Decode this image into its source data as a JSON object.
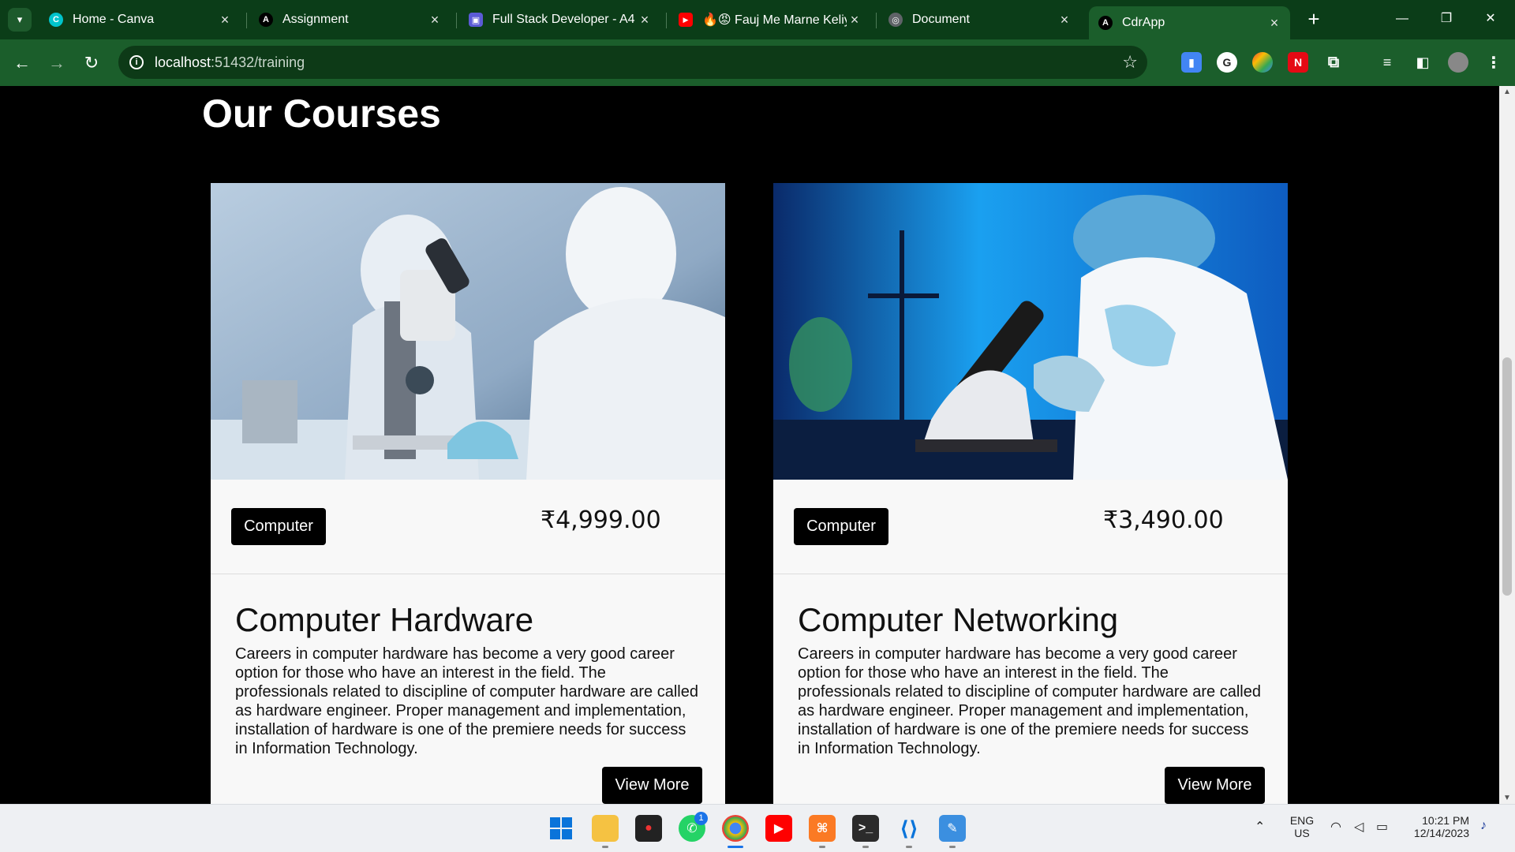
{
  "browser": {
    "tabs": [
      {
        "label": "Home - Canva",
        "fav": "C",
        "color": "#00c4cc"
      },
      {
        "label": "Assignment",
        "fav": "A",
        "color": "#000000"
      },
      {
        "label": "Full Stack Developer - A4",
        "fav": "▣",
        "color": "#5b5bd6"
      },
      {
        "label": "🔥😡 Fauj Me Marne Keliy",
        "fav": "▶",
        "color": "#ff0000"
      },
      {
        "label": "Document",
        "fav": "◎",
        "color": "#5f6368"
      },
      {
        "label": "CdrApp",
        "fav": "A",
        "color": "#000000"
      }
    ],
    "url_host": "localhost",
    "url_path": ":51432/training"
  },
  "page": {
    "title": "Our Courses",
    "courses": [
      {
        "category": "Computer",
        "price": "₹4,999.00",
        "name": "Computer Hardware",
        "description": "Careers in computer hardware has become a very good career option for those who have an interest in the field. The professionals related to discipline of computer hardware are called as hardware engineer. Proper management and implementation, installation of hardware is one of the premiere needs for success in Information Technology.",
        "button": "View More"
      },
      {
        "category": "Computer",
        "price": "₹3,490.00",
        "name": "Computer Networking",
        "description": "Careers in computer hardware has become a very good career option for those who have an interest in the field. The professionals related to discipline of computer hardware are called as hardware engineer. Proper management and implementation, installation of hardware is one of the premiere needs for success in Information Technology.",
        "button": "View More"
      }
    ]
  },
  "taskbar": {
    "lang": "ENG",
    "region": "US",
    "time": "10:21 PM",
    "date": "12/14/2023",
    "whatsapp_badge": "1"
  }
}
